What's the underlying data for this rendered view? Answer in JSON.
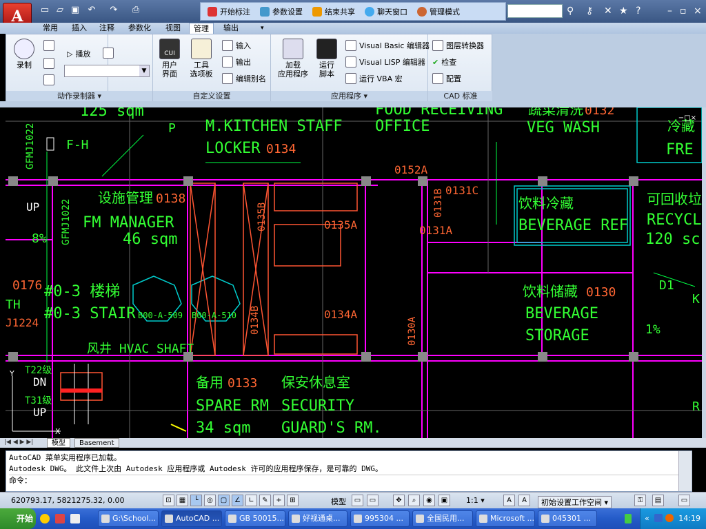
{
  "app": {
    "logo_letter": "A"
  },
  "collab": {
    "items": [
      "开始标注",
      "参数设置",
      "结束共享",
      "聊天窗口",
      "管理模式"
    ]
  },
  "tabs": [
    "常用",
    "插入",
    "注释",
    "参数化",
    "视图",
    "管理",
    "输出"
  ],
  "active_tab": "管理",
  "ribbon": {
    "action_recorder": {
      "record": "录制",
      "play": "播放",
      "title": "动作录制器 ▾"
    },
    "customize": {
      "user_interface_1": "用户",
      "user_interface_2": "界面",
      "tool_palette_1": "工具",
      "tool_palette_2": "选项板",
      "import": "输入",
      "export": "输出",
      "edit_alias": "编辑别名",
      "title": "自定义设置"
    },
    "apps": {
      "load_app_1": "加载",
      "load_app_2": "应用程序",
      "run_script_1": "运行",
      "run_script_2": "脚本",
      "vba_editor": "Visual Basic 编辑器",
      "lisp_editor": "Visual LISP 编辑器",
      "run_vba": "运行 VBA 宏",
      "title": "应用程序 ▾"
    },
    "cad_standards": {
      "layer_translator": "图层转换器",
      "check": "检查",
      "configure": "配置",
      "title": "CAD 标准"
    }
  },
  "drawing_labels": [
    {
      "text": "125  sqm",
      "color": "#33ff33"
    },
    {
      "text": "M.KITCHEN  STAFF",
      "color": "#33ff33"
    },
    {
      "text": "LOCKER",
      "color": "#33ff33"
    },
    {
      "text": "0134",
      "color": "#ff6633"
    },
    {
      "text": "FOOD  RECEIVING",
      "color": "#33ff33"
    },
    {
      "text": "OFFICE",
      "color": "#33ff33"
    },
    {
      "text": "蔬菜清洗",
      "color": "#33ff33"
    },
    {
      "text": "0132",
      "color": "#ff6633"
    },
    {
      "text": "VEG  WASH",
      "color": "#33ff33"
    },
    {
      "text": "冷藏",
      "color": "#33ff33"
    },
    {
      "text": "FRE",
      "color": "#33ff33"
    },
    {
      "text": "P",
      "color": "#33ff33"
    },
    {
      "text": "F-H",
      "color": "#33ff33"
    },
    {
      "text": "GFMJ1022",
      "color": "#33ff33"
    },
    {
      "text": "0152A",
      "color": "#ff6633"
    },
    {
      "text": "0131C",
      "color": "#ff6633"
    },
    {
      "text": "0131B",
      "color": "#ff6633"
    },
    {
      "text": "0131A",
      "color": "#ff6633"
    },
    {
      "text": "饮料冷藏",
      "color": "#33ff33"
    },
    {
      "text": "BEVERAGE  REF",
      "color": "#33ff33"
    },
    {
      "text": "可回收垃圾",
      "color": "#33ff33"
    },
    {
      "text": "RECYCL",
      "color": "#33ff33"
    },
    {
      "text": "120  sc",
      "color": "#33ff33"
    },
    {
      "text": "设施管理",
      "color": "#33ff33"
    },
    {
      "text": "0138",
      "color": "#ff6633"
    },
    {
      "text": "FM  MANAGER",
      "color": "#33ff33"
    },
    {
      "text": "46  sqm",
      "color": "#33ff33"
    },
    {
      "text": "0135B",
      "color": "#ff6633"
    },
    {
      "text": "0135A",
      "color": "#ff6633"
    },
    {
      "text": "GFMJ1022",
      "color": "#33ff33"
    },
    {
      "text": "UP",
      "color": "#ffffff"
    },
    {
      "text": "8%",
      "color": "#33ff33"
    },
    {
      "text": "0176",
      "color": "#ff6633"
    },
    {
      "text": "#0-3  楼梯",
      "color": "#33ff33"
    },
    {
      "text": "#0-3  STAIR",
      "color": "#33ff33"
    },
    {
      "text": "B00-A-509",
      "color": "#33ff33"
    },
    {
      "text": "B00-A-510",
      "color": "#33ff33"
    },
    {
      "text": "TH",
      "color": "#33ff33"
    },
    {
      "text": "J1224",
      "color": "#ff6633"
    },
    {
      "text": "0134B",
      "color": "#ff6633"
    },
    {
      "text": "0134A",
      "color": "#ff6633"
    },
    {
      "text": "0130A",
      "color": "#ff6633"
    },
    {
      "text": "饮料储藏",
      "color": "#33ff33"
    },
    {
      "text": "0130",
      "color": "#ff6633"
    },
    {
      "text": "BEVERAGE",
      "color": "#33ff33"
    },
    {
      "text": "STORAGE",
      "color": "#33ff33"
    },
    {
      "text": "D1",
      "color": "#33ff33"
    },
    {
      "text": "1%",
      "color": "#33ff33"
    },
    {
      "text": "风井  HVAC  SHAFT",
      "color": "#33ff33"
    },
    {
      "text": "T22级",
      "color": "#33ff33"
    },
    {
      "text": "DN",
      "color": "#ffffff"
    },
    {
      "text": "T31级",
      "color": "#33ff33"
    },
    {
      "text": "UP",
      "color": "#ffffff"
    },
    {
      "text": "备用",
      "color": "#33ff33"
    },
    {
      "text": "0133",
      "color": "#ff6633"
    },
    {
      "text": "保安休息室",
      "color": "#33ff33"
    },
    {
      "text": "SPARE  RM",
      "color": "#33ff33"
    },
    {
      "text": "SECURITY",
      "color": "#33ff33"
    },
    {
      "text": "34  sqm",
      "color": "#33ff33"
    },
    {
      "text": "GUARD'S  RM.",
      "color": "#33ff33"
    },
    {
      "text": "K",
      "color": "#33ff33"
    },
    {
      "text": "R",
      "color": "#33ff33"
    }
  ],
  "model_tabs": [
    "模型",
    "Basement"
  ],
  "command": {
    "line1": "AutoCAD 菜单实用程序已加载。",
    "line2": "Autodesk DWG。  此文件上次由 Autodesk 应用程序或 Autodesk 许可的应用程序保存，是可靠的 DWG。",
    "prompt": "命令："
  },
  "status": {
    "coords": "620793.17, 5821275.32, 0.00",
    "model_label": "模型",
    "scale": "1:1 ▾",
    "workspace": "初始设置工作空间 ▾"
  },
  "taskbar": {
    "start": "开始",
    "items": [
      "G:\\School...",
      "AutoCAD ...",
      "GB 50015...",
      "好视通桌...",
      "995304 ...",
      "全国民用...",
      "Microsoft ...",
      "045301 ..."
    ],
    "active_index": 1,
    "clock": "14:19"
  }
}
